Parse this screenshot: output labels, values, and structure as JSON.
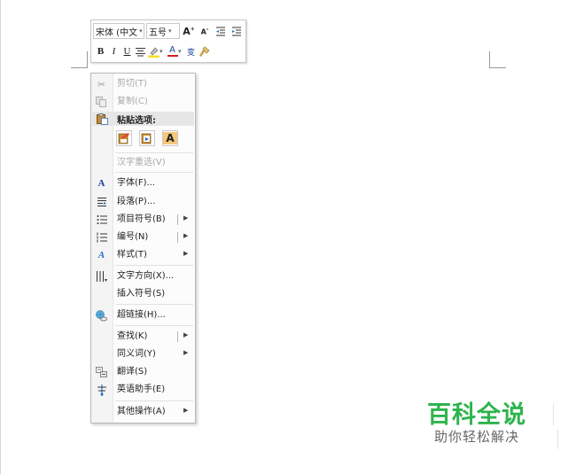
{
  "mini_toolbar": {
    "font_name": "宋体 (中文",
    "font_size": "五号",
    "grow_font": "A",
    "shrink_font": "A",
    "bold": "B",
    "italic": "I",
    "underline": "U",
    "font_color_glyph": "A",
    "phonetic_glyph": "变",
    "highlight_color": "#f5e12a",
    "font_color": "#d22020"
  },
  "context_menu": {
    "items": [
      {
        "label": "剪切(T)",
        "icon": "scissors-icon",
        "disabled": true
      },
      {
        "label": "复制(C)",
        "icon": "copy-icon",
        "disabled": true
      },
      {
        "label": "粘贴选项:",
        "icon": "paste-icon",
        "header": true
      },
      {
        "label": "汉字重选(V)",
        "icon": "",
        "disabled": true
      },
      {
        "label": "字体(F)...",
        "icon": "font-icon"
      },
      {
        "label": "段落(P)...",
        "icon": "paragraph-icon"
      },
      {
        "label": "项目符号(B)",
        "icon": "bullets-icon",
        "submenu": true
      },
      {
        "label": "编号(N)",
        "icon": "numbering-icon",
        "submenu": true
      },
      {
        "label": "样式(T)",
        "icon": "styles-icon",
        "submenu": true
      },
      {
        "label": "文字方向(X)...",
        "icon": "text-direction-icon"
      },
      {
        "label": "插入符号(S)",
        "icon": ""
      },
      {
        "label": "超链接(H)...",
        "icon": "hyperlink-icon"
      },
      {
        "label": "查找(K)",
        "icon": "",
        "submenu": true
      },
      {
        "label": "同义词(Y)",
        "icon": "",
        "submenu": true
      },
      {
        "label": "翻译(S)",
        "icon": "translate-icon"
      },
      {
        "label": "英语助手(E)",
        "icon": "english-assistant-icon"
      },
      {
        "label": "其他操作(A)",
        "icon": "",
        "submenu": true
      }
    ],
    "paste_keep_text": "A"
  },
  "watermark": {
    "title": "百科全说",
    "subtitle": "助你轻松解决",
    "color": "#2db44d"
  }
}
